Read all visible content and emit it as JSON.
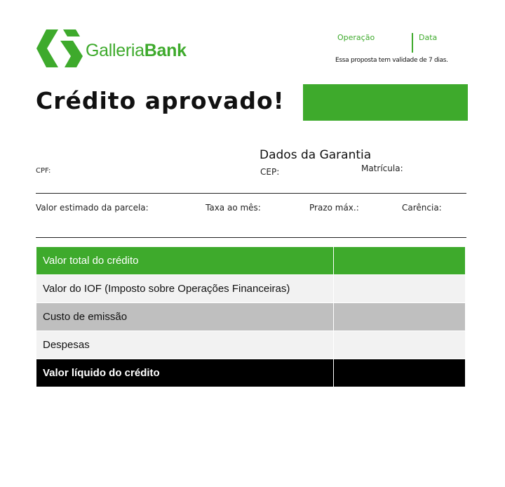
{
  "brand": {
    "name_light": "Galleria",
    "name_bold": "Bank",
    "color": "#3eaa2c"
  },
  "header": {
    "operation_label": "Operação",
    "date_label": "Data",
    "validity_note": "Essa proposta tem validade de 7 dias."
  },
  "title": "Crédito aprovado!",
  "guarantee_heading": "Dados da Garantia",
  "fields": {
    "cpf": "CPF:",
    "cep": "CEP:",
    "matricula": "Matrícula:",
    "parcela": "Valor estimado  da parcela:",
    "taxa": "Taxa ao mês:",
    "prazo": "Prazo máx.:",
    "carencia": "Carência:"
  },
  "table": {
    "rows": [
      {
        "label": "Valor total do crédito",
        "value": "",
        "style": "green"
      },
      {
        "label": "Valor do IOF (Imposto sobre Operações Financeiras)",
        "value": "",
        "style": "light"
      },
      {
        "label": "Custo de emissão",
        "value": "",
        "style": "gray"
      },
      {
        "label": "Despesas",
        "value": "",
        "style": "light"
      },
      {
        "label": "Valor líquido do crédito",
        "value": "",
        "style": "black"
      }
    ]
  }
}
